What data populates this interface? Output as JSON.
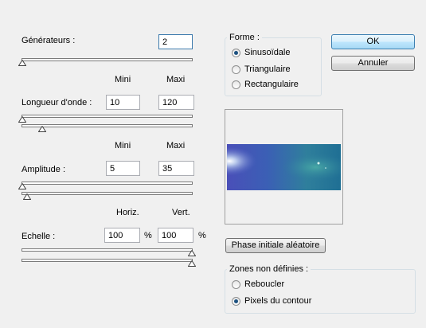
{
  "generators": {
    "label": "Générateurs :",
    "value": "2"
  },
  "column_headers": {
    "wavelength": {
      "min": "Mini",
      "max": "Maxi"
    },
    "amplitude": {
      "min": "Mini",
      "max": "Maxi"
    },
    "scale": {
      "horiz": "Horiz.",
      "vert": "Vert."
    }
  },
  "wavelength": {
    "label": "Longueur d'onde :",
    "min": "10",
    "max": "120"
  },
  "amplitude": {
    "label": "Amplitude :",
    "min": "5",
    "max": "35"
  },
  "scale": {
    "label": "Echelle :",
    "horiz": "100",
    "vert": "100",
    "unit": "%"
  },
  "form": {
    "legend": "Forme :",
    "options": [
      "Sinusoïdale",
      "Triangulaire",
      "Rectangulaire"
    ],
    "selected": "Sinusoïdale"
  },
  "buttons": {
    "ok": "OK",
    "cancel": "Annuler",
    "random_phase": "Phase initiale aléatoire"
  },
  "undefined_zones": {
    "legend": "Zones non définies :",
    "options": [
      "Reboucler",
      "Pixels du contour"
    ],
    "selected": "Pixels du contour"
  }
}
